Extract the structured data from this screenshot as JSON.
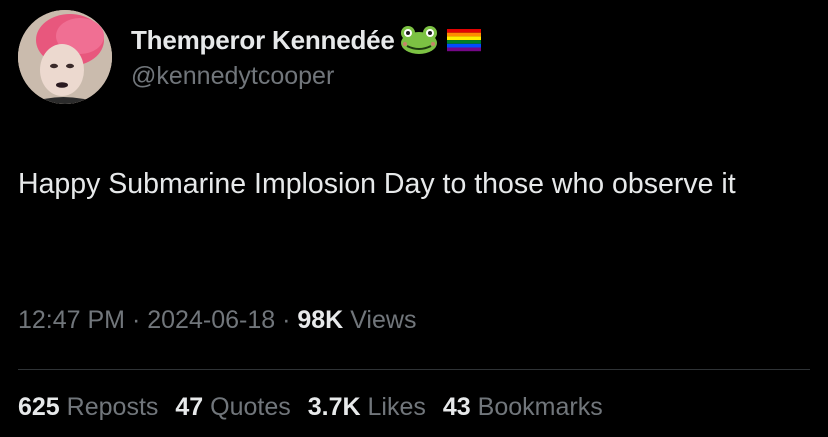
{
  "author": {
    "display_name": "Themperor Kennedée",
    "handle": "@kennedytcooper",
    "name_emojis": [
      "frog-emoji",
      "rainbow-flag-emoji"
    ]
  },
  "tweet": {
    "text": "Happy Submarine Implosion Day to those who observe it"
  },
  "meta": {
    "time": "12:47 PM",
    "date": "2024-06-18",
    "separator": "·",
    "views_count": "98K",
    "views_label": "Views"
  },
  "stats": {
    "reposts_count": "625",
    "reposts_label": "Reposts",
    "quotes_count": "47",
    "quotes_label": "Quotes",
    "likes_count": "3.7K",
    "likes_label": "Likes",
    "bookmarks_count": "43",
    "bookmarks_label": "Bookmarks"
  },
  "colors": {
    "background": "#000000",
    "primary_text": "#e7e9ea",
    "secondary_text": "#71767b",
    "divider": "#2f3336"
  }
}
